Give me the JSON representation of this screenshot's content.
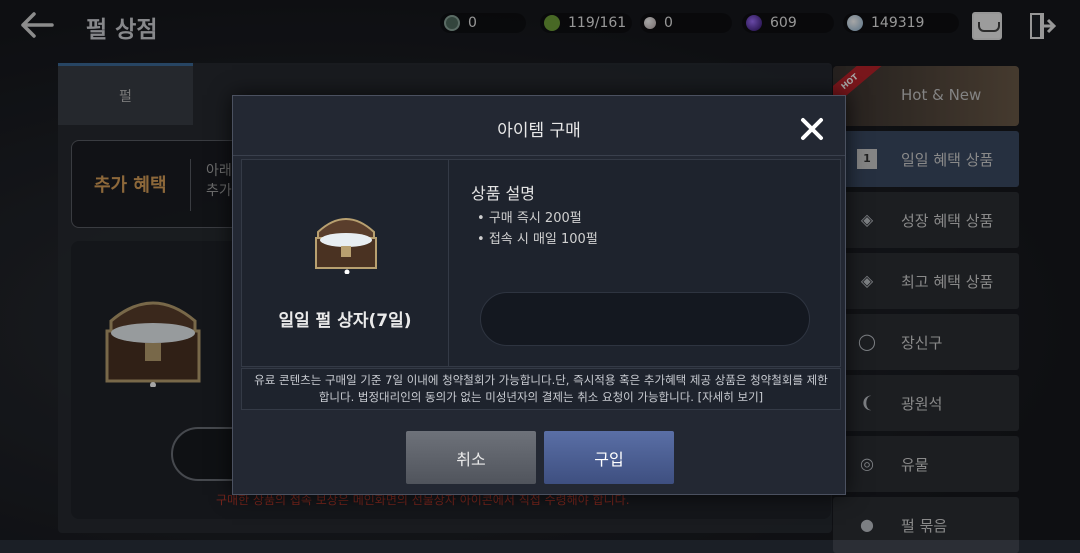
{
  "header": {
    "title": "펄 상점",
    "currencies": [
      {
        "icon": "green-gem-icon",
        "value": "0",
        "color": "#4f6b5e"
      },
      {
        "icon": "leaf-orb-icon",
        "value": "119/161",
        "color": "#6fa03a"
      },
      {
        "icon": "pearl-icon",
        "value": "0",
        "color": "#d8c8c8"
      },
      {
        "icon": "purple-orb-icon",
        "value": "609",
        "color": "#5a2fa8"
      },
      {
        "icon": "silver-coin-icon",
        "value": "149319",
        "color": "#c8d8e8"
      }
    ]
  },
  "shop": {
    "tabs": [
      {
        "label": "펄"
      },
      {
        "label": ""
      },
      {
        "label": ""
      }
    ],
    "bonus_label": "추가 혜택",
    "bonus_desc_1": "아래",
    "bonus_desc_2": "추가",
    "card_footer": "구매한 상품의 접속 보상은 메인화면의 선물상자 아이콘에서 직접 수령해야 합니다."
  },
  "sidebar": {
    "hot_badge": "HOT",
    "hot_label": "Hot & New",
    "items": [
      {
        "label": "일일 혜택 상품",
        "icon": "calendar-icon",
        "glyph": "1"
      },
      {
        "label": "성장 혜택 상품",
        "icon": "box-icon",
        "glyph": "◈"
      },
      {
        "label": "최고 혜택 상품",
        "icon": "gift-box-icon",
        "glyph": "◈"
      },
      {
        "label": "장신구",
        "icon": "ring-icon",
        "glyph": "◯"
      },
      {
        "label": "광원석",
        "icon": "ore-icon",
        "glyph": "❨"
      },
      {
        "label": "유물",
        "icon": "relic-icon",
        "glyph": "◎"
      },
      {
        "label": "펄 묶음",
        "icon": "pearl-bundle-icon",
        "glyph": "●"
      }
    ]
  },
  "modal": {
    "title": "아이템 구매",
    "item_name": "일일 펄 상자(7일)",
    "desc_title": "상품 설명",
    "desc_items": [
      "구매 즉시 200펄",
      "접속 시 매일 100펄"
    ],
    "notice": "유료 콘텐츠는 구매일 기준 7일 이내에 청약철회가 가능합니다.단, 즉시적용 혹은 추가혜택 제공 상품은 청약철회를 제한합니다. 법정대리인의 동의가 없는 미성년자의 결제는 취소 요청이 가능합니다. [자세히 보기]",
    "cancel_label": "취소",
    "buy_label": "구입"
  }
}
